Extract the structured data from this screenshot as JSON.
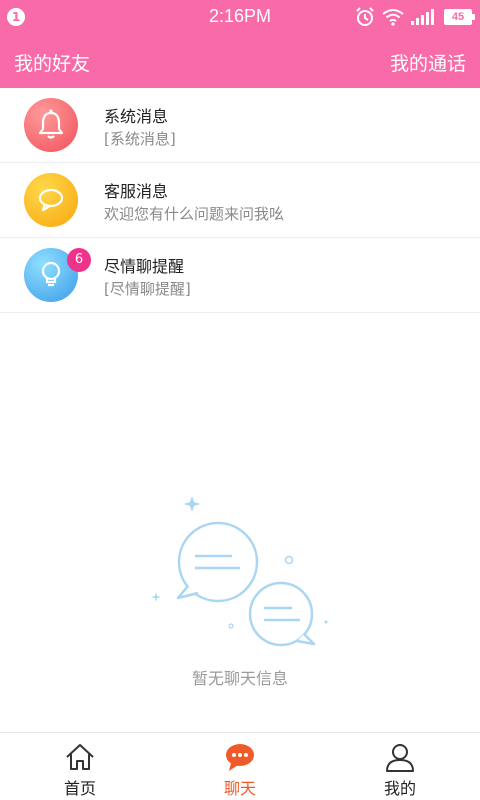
{
  "status_bar": {
    "notification_count": "1",
    "time": "2:16PM",
    "battery": "45"
  },
  "header": {
    "left_label": "我的好友",
    "right_label": "我的通话"
  },
  "messages": [
    {
      "title": "系统消息",
      "subtitle": "[系统消息]",
      "icon": "bell-icon",
      "color": "#f0505a"
    },
    {
      "title": "客服消息",
      "subtitle": "欢迎您有什么问题来问我吆",
      "icon": "chat-bubble-icon",
      "color": "#f7a70f"
    },
    {
      "title": "尽情聊提醒",
      "subtitle": "[尽情聊提醒]",
      "icon": "lightbulb-icon",
      "color": "#3a9ae8",
      "badge": "6"
    }
  ],
  "empty_state": {
    "text": "暂无聊天信息",
    "icon": "empty-chat-icon"
  },
  "tabs": [
    {
      "label": "首页",
      "icon": "home-icon",
      "active": false
    },
    {
      "label": "聊天",
      "icon": "chat-icon",
      "active": true
    },
    {
      "label": "我的",
      "icon": "user-icon",
      "active": false
    }
  ],
  "colors": {
    "brand": "#f96ba8",
    "active_tab": "#f05a28",
    "badge": "#f0338a"
  }
}
